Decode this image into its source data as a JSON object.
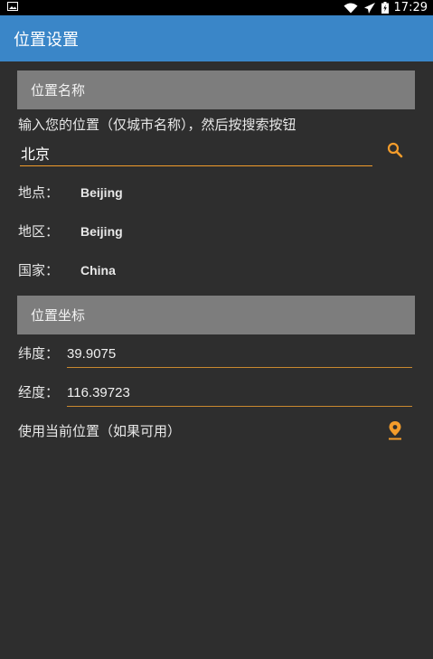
{
  "status_bar": {
    "time": "17:29",
    "icons": [
      "image-icon",
      "wifi-icon",
      "airplane-icon",
      "battery-icon"
    ]
  },
  "app_bar": {
    "title": "位置设置"
  },
  "location_name": {
    "header": "位置名称",
    "instruction": "输入您的位置（仅城市名称），然后按搜索按钮",
    "search_value": "北京",
    "search_icon": "search-icon"
  },
  "details": [
    {
      "label": "地点：",
      "value": "Beijing"
    },
    {
      "label": "地区：",
      "value": "Beijing"
    },
    {
      "label": "国家：",
      "value": "China"
    }
  ],
  "coordinates": {
    "header": "位置坐标",
    "latitude_label": "纬度：",
    "latitude_value": "39.9075",
    "longitude_label": "经度：",
    "longitude_value": "116.39723"
  },
  "current_location": {
    "label": "使用当前位置（如果可用）",
    "icon": "location-pin-icon"
  },
  "colors": {
    "app_bar": "#3a86c8",
    "accent": "#f39c2b",
    "background": "#2e2e2e",
    "section_header": "#7d7d7d"
  }
}
